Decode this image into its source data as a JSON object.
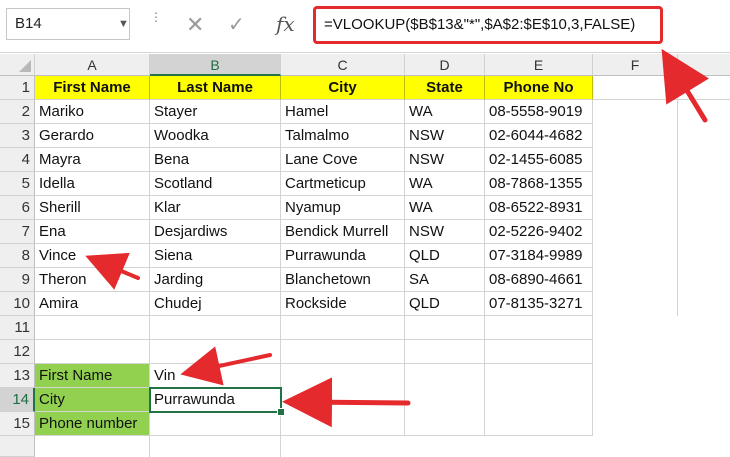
{
  "formula_bar": {
    "name_box": "B14",
    "cancel_icon": "✕",
    "enter_icon": "✓",
    "function_icon": "fx",
    "formula": "=VLOOKUP($B$13&\"*\",$A$2:$E$10,3,FALSE)"
  },
  "columns": [
    "A",
    "B",
    "C",
    "D",
    "E",
    "F"
  ],
  "rows": [
    "1",
    "2",
    "3",
    "4",
    "5",
    "6",
    "7",
    "8",
    "9",
    "10",
    "11",
    "12",
    "13",
    "14",
    "15"
  ],
  "table": {
    "headers": [
      "First Name",
      "Last Name",
      "City",
      "State",
      "Phone No"
    ],
    "rows": [
      [
        "Mariko",
        "Stayer",
        "Hamel",
        "WA",
        "08-5558-9019"
      ],
      [
        "Gerardo",
        "Woodka",
        "Talmalmo",
        "NSW",
        "02-6044-4682"
      ],
      [
        "Mayra",
        "Bena",
        "Lane Cove",
        "NSW",
        "02-1455-6085"
      ],
      [
        "Idella",
        "Scotland",
        "Cartmeticup",
        "WA",
        "08-7868-1355"
      ],
      [
        "Sherill",
        "Klar",
        "Nyamup",
        "WA",
        "08-6522-8931"
      ],
      [
        "Ena",
        "Desjardiws",
        "Bendick Murrell",
        "NSW",
        "02-5226-9402"
      ],
      [
        "Vince",
        "Siena",
        "Purrawunda",
        "QLD",
        "07-3184-9989"
      ],
      [
        "Theron",
        "Jarding",
        "Blanchetown",
        "SA",
        "08-6890-4661"
      ],
      [
        "Amira",
        "Chudej",
        "Rockside",
        "QLD",
        "07-8135-3271"
      ]
    ]
  },
  "lookup": {
    "first_name_label": "First Name",
    "first_name_value": "Vin",
    "city_label": "City",
    "city_value": "Purrawunda",
    "phone_label": "Phone number",
    "phone_value": ""
  },
  "colors": {
    "header_fill": "#ffff00",
    "label_fill": "#92d050",
    "annotation_red": "#e52a2e",
    "selection_green": "#217346"
  }
}
